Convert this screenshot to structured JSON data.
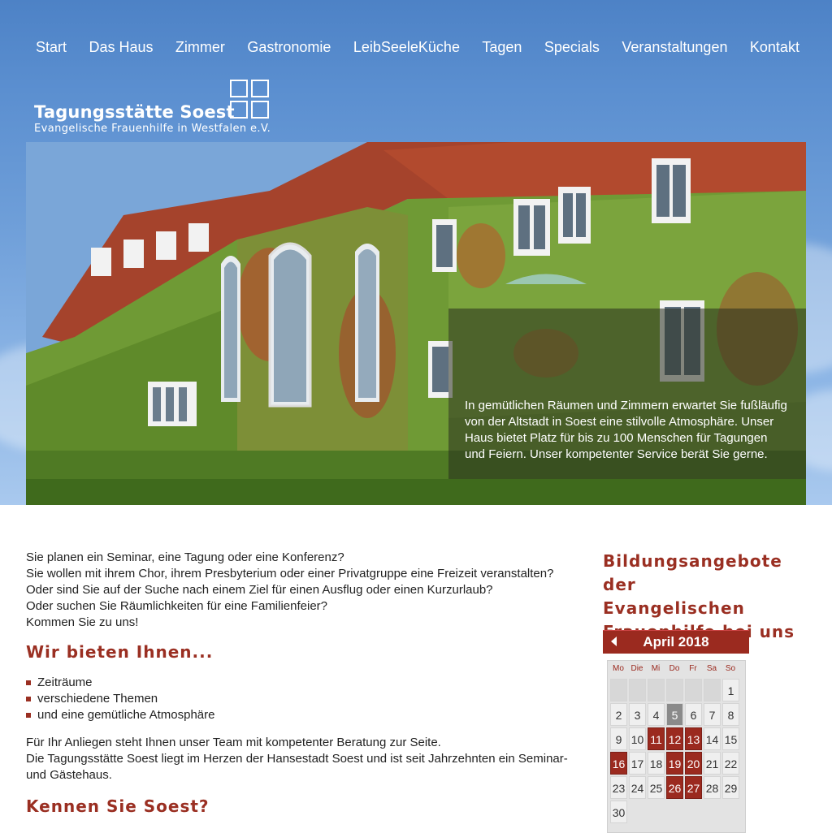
{
  "nav": {
    "items": [
      "Start",
      "Das Haus",
      "Zimmer",
      "Gastronomie",
      "LeibSeeleKüche",
      "Tagen",
      "Specials",
      "Veranstaltungen",
      "Kontakt"
    ]
  },
  "logo": {
    "title": "Tagungsstätte Soest",
    "subtitle": "Evangelische Frauenhilfe in Westfalen e.V."
  },
  "hero": {
    "caption": "In gemütlichen Räumen und Zimmern erwartet Sie fußläufig von der Altstadt in Soest eine stilvolle Atmosphäre. Unser Haus bietet Platz für bis zu 100 Menschen für Tagungen und Feiern. Unser kompetenter Service berät Sie gerne."
  },
  "main": {
    "intro": [
      "Sie planen ein Seminar, eine Tagung oder eine Konferenz?",
      "Sie wollen mit ihrem Chor, ihrem Presbyterium oder einer Privatgruppe eine Freizeit veranstalten?",
      "Oder sind Sie auf der Suche nach einem Ziel für einen Ausflug oder einen Kurzurlaub?",
      "Oder suchen Sie Räumlichkeiten für eine Familienfeier?",
      "Kommen Sie zu uns!"
    ],
    "heading_offer": "Wir bieten Ihnen...",
    "offer_items": [
      "Zeiträume",
      "verschiedene Themen",
      "und eine gemütliche Atmosphäre"
    ],
    "team_lines": [
      "Für Ihr Anliegen steht Ihnen unser Team mit kompetenter Beratung zur Seite.",
      "Die Tagungsstätte Soest liegt im Herzen der Hansestadt Soest und ist seit Jahrzehnten ein Seminar- und Gästehaus."
    ],
    "heading_soest": "Kennen Sie Soest?"
  },
  "sidebar": {
    "heading": [
      "Bildungsangebote der",
      "Evangelischen",
      "Frauenhilfe bei uns"
    ],
    "calendar": {
      "month": "April 2018",
      "weekdays": [
        "Mo",
        "Die",
        "Mi",
        "Do",
        "Fr",
        "Sa",
        "So"
      ],
      "weeks": [
        [
          "",
          "",
          "",
          "",
          "",
          "",
          "1"
        ],
        [
          "2",
          "3",
          "4",
          "5",
          "6",
          "7",
          "8"
        ],
        [
          "9",
          "10",
          "11",
          "12",
          "13",
          "14",
          "15"
        ],
        [
          "16",
          "17",
          "18",
          "19",
          "20",
          "21",
          "22"
        ],
        [
          "23",
          "24",
          "25",
          "26",
          "27",
          "28",
          "29"
        ],
        [
          "30",
          "",
          "",
          "",
          "",
          "",
          ""
        ]
      ],
      "event_days": [
        "11",
        "12",
        "13",
        "16",
        "19",
        "20",
        "26",
        "27"
      ],
      "today": "5"
    }
  },
  "colors": {
    "accent": "#9b2a1f",
    "sky": "#5b8fd0"
  }
}
